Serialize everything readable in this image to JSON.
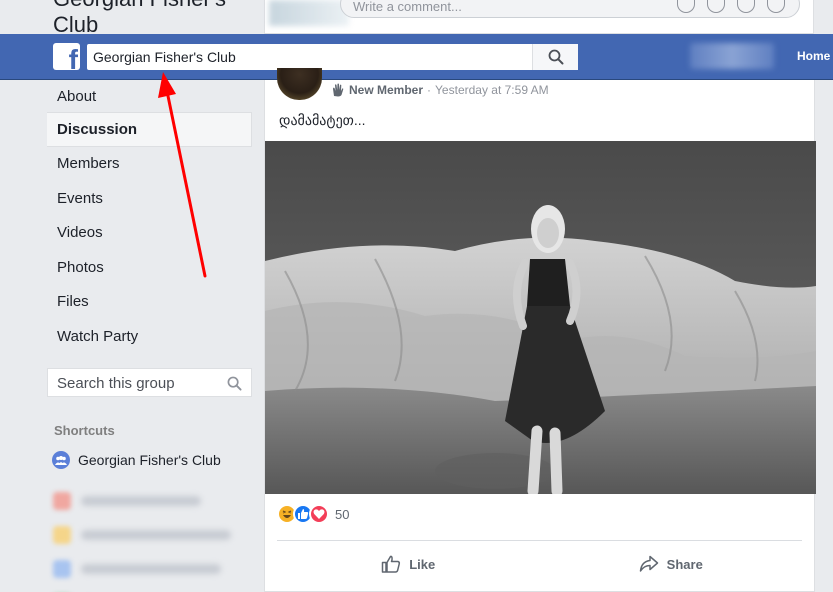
{
  "group": {
    "title": "Georgian Fisher's Club"
  },
  "top_comment": {
    "placeholder": "Write a comment..."
  },
  "header": {
    "search_value": "Georgian Fisher's Club",
    "home_label": "Home"
  },
  "nav": {
    "items": [
      {
        "label": "About"
      },
      {
        "label": "Discussion"
      },
      {
        "label": "Members"
      },
      {
        "label": "Events"
      },
      {
        "label": "Videos"
      },
      {
        "label": "Photos"
      },
      {
        "label": "Files"
      },
      {
        "label": "Watch Party"
      }
    ],
    "active": "Discussion",
    "search_placeholder": "Search this group"
  },
  "shortcuts": {
    "title": "Shortcuts",
    "items": [
      {
        "label": "Georgian Fisher's Club"
      }
    ]
  },
  "post": {
    "badge": "New Member",
    "separator": "·",
    "timestamp": "Yesterday at 7:59 AM",
    "text": "დამამატეთ...",
    "reaction_count": "50",
    "like_label": "Like",
    "share_label": "Share"
  },
  "colors": {
    "header_blue": "#4267b2",
    "arrow_red": "#ff0000"
  }
}
